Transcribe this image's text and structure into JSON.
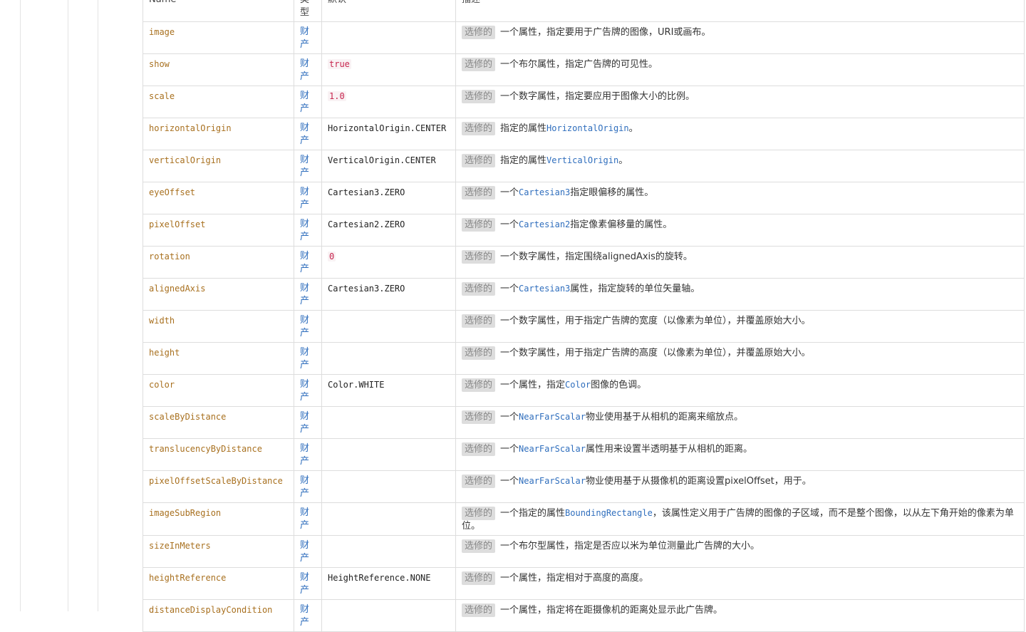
{
  "colors": {
    "border": "#dddddd",
    "name": "#a8701f",
    "link": "#2f6ebd",
    "literal": "#c7254e",
    "badge_bg": "#dddddd",
    "badge_text": "#888888"
  },
  "table": {
    "columns": {
      "name": "Name",
      "type": "类型",
      "default": "默认",
      "description": "描述"
    },
    "optional_badge": "选修的",
    "rows": [
      {
        "name": "image",
        "type": "财产",
        "default": "",
        "literal": false,
        "description": [
          {
            "text": "一个属性，指定要用于广告牌的图像，URI或画布。"
          }
        ]
      },
      {
        "name": "show",
        "type": "财产",
        "default": "true",
        "literal": true,
        "description": [
          {
            "text": "一个布尔属性，指定广告牌的可见性。"
          }
        ]
      },
      {
        "name": "scale",
        "type": "财产",
        "default": "1.0",
        "literal": true,
        "description": [
          {
            "text": "一个数字属性，指定要应用于图像大小的比例。"
          }
        ]
      },
      {
        "name": "horizontalOrigin",
        "type": "财产",
        "default": "HorizontalOrigin.CENTER",
        "literal": false,
        "description": [
          {
            "text": "指定的属性"
          },
          {
            "text": "HorizontalOrigin",
            "link": true
          },
          {
            "text": "。"
          }
        ]
      },
      {
        "name": "verticalOrigin",
        "type": "财产",
        "default": "VerticalOrigin.CENTER",
        "literal": false,
        "description": [
          {
            "text": "指定的属性"
          },
          {
            "text": "VerticalOrigin",
            "link": true
          },
          {
            "text": "。"
          }
        ]
      },
      {
        "name": "eyeOffset",
        "type": "财产",
        "default": "Cartesian3.ZERO",
        "literal": false,
        "description": [
          {
            "text": "一个"
          },
          {
            "text": "Cartesian3",
            "link": true
          },
          {
            "text": "指定眼偏移的属性。"
          }
        ]
      },
      {
        "name": "pixelOffset",
        "type": "财产",
        "default": "Cartesian2.ZERO",
        "literal": false,
        "description": [
          {
            "text": "一个"
          },
          {
            "text": "Cartesian2",
            "link": true
          },
          {
            "text": "指定像素偏移量的属性。"
          }
        ]
      },
      {
        "name": "rotation",
        "type": "财产",
        "default": "0",
        "literal": true,
        "description": [
          {
            "text": "一个数字属性，指定围绕alignedAxis的旋转。"
          }
        ]
      },
      {
        "name": "alignedAxis",
        "type": "财产",
        "default": "Cartesian3.ZERO",
        "literal": false,
        "description": [
          {
            "text": "一个"
          },
          {
            "text": "Cartesian3",
            "link": true
          },
          {
            "text": "属性，指定旋转的单位矢量轴。"
          }
        ]
      },
      {
        "name": "width",
        "type": "财产",
        "default": "",
        "literal": false,
        "description": [
          {
            "text": "一个数字属性，用于指定广告牌的宽度（以像素为单位），并覆盖原始大小。"
          }
        ]
      },
      {
        "name": "height",
        "type": "财产",
        "default": "",
        "literal": false,
        "description": [
          {
            "text": "一个数字属性，用于指定广告牌的高度（以像素为单位），并覆盖原始大小。"
          }
        ]
      },
      {
        "name": "color",
        "type": "财产",
        "default": "Color.WHITE",
        "literal": false,
        "description": [
          {
            "text": "一个属性，指定"
          },
          {
            "text": "Color",
            "link": true
          },
          {
            "text": "图像的色调。"
          }
        ]
      },
      {
        "name": "scaleByDistance",
        "type": "财产",
        "default": "",
        "literal": false,
        "description": [
          {
            "text": "一个"
          },
          {
            "text": "NearFarScalar",
            "link": true
          },
          {
            "text": "物业使用基于从相机的距离来缩放点。"
          }
        ]
      },
      {
        "name": "translucencyByDistance",
        "type": "财产",
        "default": "",
        "literal": false,
        "description": [
          {
            "text": "一个"
          },
          {
            "text": "NearFarScalar",
            "link": true
          },
          {
            "text": "属性用来设置半透明基于从相机的距离。"
          }
        ]
      },
      {
        "name": "pixelOffsetScaleByDistance",
        "type": "财产",
        "default": "",
        "literal": false,
        "description": [
          {
            "text": "一个"
          },
          {
            "text": "NearFarScalar",
            "link": true
          },
          {
            "text": "物业使用基于从摄像机的距离设置pixelOffset，用于。"
          }
        ]
      },
      {
        "name": "imageSubRegion",
        "type": "财产",
        "default": "",
        "literal": false,
        "description": [
          {
            "text": "一个指定的属性"
          },
          {
            "text": "BoundingRectangle",
            "link": true
          },
          {
            "text": "，该属性定义用于广告牌的图像的子区域，而不是整个图像，以从左下角开始的像素为单位。"
          }
        ]
      },
      {
        "name": "sizeInMeters",
        "type": "财产",
        "default": "",
        "literal": false,
        "description": [
          {
            "text": "一个布尔型属性，指定是否应以米为单位测量此广告牌的大小。"
          }
        ]
      },
      {
        "name": "heightReference",
        "type": "财产",
        "default": "HeightReference.NONE",
        "literal": false,
        "description": [
          {
            "text": "一个属性，指定相对于高度的高度。"
          }
        ]
      },
      {
        "name": "distanceDisplayCondition",
        "type": "财产",
        "default": "",
        "literal": false,
        "description": [
          {
            "text": "一个属性，指定将在距摄像机的距离处显示此广告牌。"
          }
        ]
      }
    ]
  }
}
